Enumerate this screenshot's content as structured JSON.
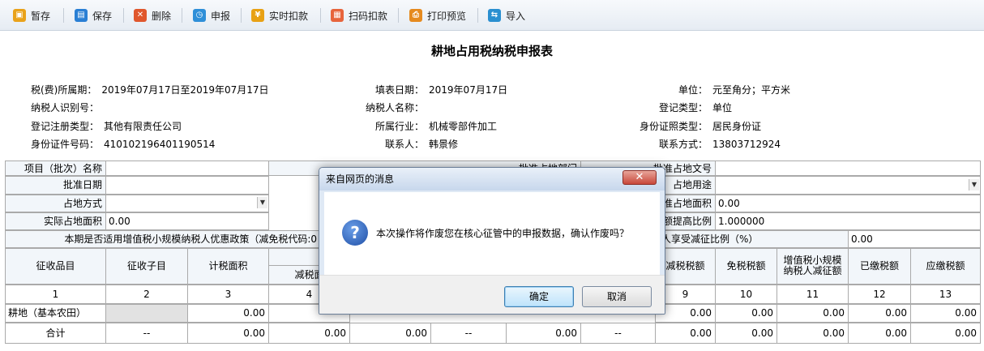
{
  "toolbar": {
    "items": [
      {
        "label": "暂存",
        "icon": "save-draft-icon",
        "color": "#e9a21a",
        "glyph": "▣"
      },
      {
        "label": "保存",
        "icon": "save-icon",
        "color": "#2a7fd4",
        "glyph": "▤"
      },
      {
        "label": "删除",
        "icon": "delete-icon",
        "color": "#e0572d",
        "glyph": "✕"
      },
      {
        "label": "申报",
        "icon": "declare-icon",
        "color": "#2f8fd8",
        "glyph": "◷"
      },
      {
        "label": "实时扣款",
        "icon": "realtime-deduct-icon",
        "color": "#e8a114",
        "glyph": "¥"
      },
      {
        "label": "扫码扣款",
        "icon": "scan-code-icon",
        "color": "#e7643c",
        "glyph": "▦"
      },
      {
        "label": "打印预览",
        "icon": "print-preview-icon",
        "color": "#e58a1f",
        "glyph": "⎙"
      },
      {
        "label": "导入",
        "icon": "import-icon",
        "color": "#2a8fd0",
        "glyph": "⇆"
      }
    ]
  },
  "page_title": "耕地占用税纳税申报表",
  "info": {
    "period_label": "税(费)所属期：",
    "period_value": "2019年07月17日至2019年07月17日",
    "fill_date_label": "填表日期：",
    "fill_date_value": "2019年07月17日",
    "unit_label": "单位：",
    "unit_value": "元至角分；平方米",
    "taxpayer_id_label": "纳税人识别号：",
    "taxpayer_id_value": "",
    "taxpayer_name_label": "纳税人名称：",
    "taxpayer_name_value": "",
    "reg_type_label": "登记类型：",
    "reg_type_value": "单位",
    "reg_reg_type_label": "登记注册类型：",
    "reg_reg_type_value": "其他有限责任公司",
    "industry_label": "所属行业：",
    "industry_value": "机械零部件加工",
    "id_type_label": "身份证照类型：",
    "id_type_value": "居民身份证",
    "id_no_label": "身份证件号码：",
    "id_no_value": "410102196401190514",
    "contact_label": "联系人：",
    "contact_value": "韩景修",
    "phone_label": "联系方式：",
    "phone_value": "13803712924"
  },
  "form": {
    "project_name_label": "项目（批次）名称",
    "approve_dept_label": "批准占地部门",
    "approve_doc_label": "批准占地文号",
    "approve_date_label": "批准日期",
    "land_use_label": "占地用途",
    "occupy_method_label": "占地方式",
    "approve_area_label": "批准占地面积",
    "approve_area_value": "0.00",
    "actual_area_label": "实际占地面积",
    "actual_area_value": "0.00",
    "rate_increase_label": "税额提高比例",
    "rate_increase_value": "1.000000",
    "policy_label": "本期是否适用增值税小规模纳税人优惠政策（减免税代码:0",
    "reduce_ratio_label": "增值税小规模纳税人享受减征比例（%）",
    "reduce_ratio_value": "0.00"
  },
  "table": {
    "headers": [
      "征收品目",
      "征收子目",
      "计税面积",
      "减税面",
      "",
      "",
      "",
      "",
      "减税税额",
      "免税税额",
      "增值税小规模纳税人减征额",
      "已缴税额",
      "应缴税额"
    ],
    "numbers": [
      "1",
      "2",
      "3",
      "4",
      "",
      "",
      "",
      "",
      "9",
      "10",
      "11",
      "12",
      "13"
    ],
    "row1": [
      "耕地（基本农田）",
      "",
      "0.00",
      "",
      "",
      "",
      "",
      "",
      "0.00",
      "0.00",
      "0.00",
      "0.00",
      "0.00"
    ],
    "total": [
      "合计",
      "--",
      "0.00",
      "0.00",
      "0.00",
      "--",
      "0.00",
      "--",
      "0.00",
      "0.00",
      "0.00",
      "0.00",
      "0.00"
    ]
  },
  "dialog": {
    "title": "来自网页的消息",
    "close_glyph": "✕",
    "icon_glyph": "?",
    "message": "本次操作将作废您在核心征管中的申报数据，确认作废吗？",
    "ok_label": "确定",
    "cancel_label": "取消"
  }
}
